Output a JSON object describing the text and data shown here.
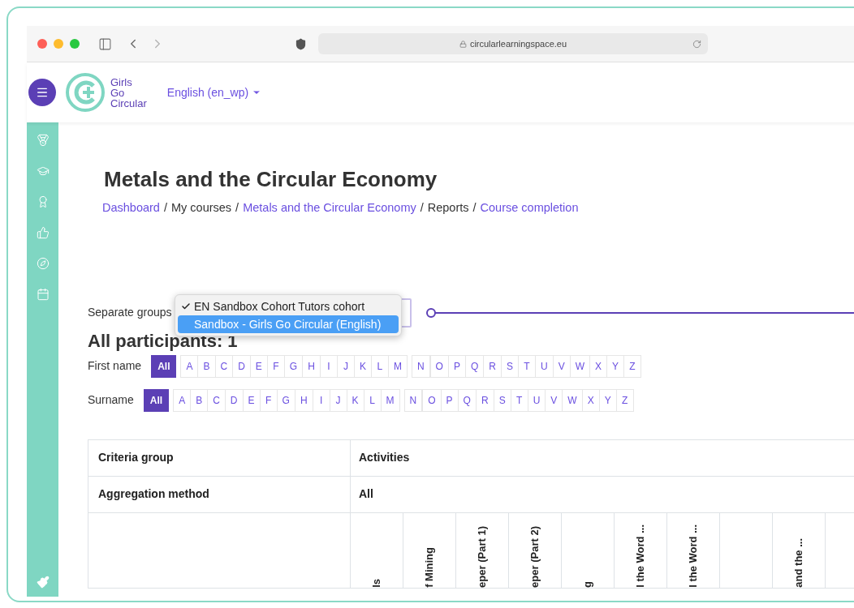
{
  "browser": {
    "url": "circularlearningspace.eu"
  },
  "header": {
    "logo_lines": [
      "Girls",
      "Go",
      "Circular"
    ],
    "language": "English (en_wp)"
  },
  "page": {
    "title": "Metals and the Circular Economy",
    "breadcrumb": [
      {
        "label": "Dashboard",
        "kind": "link"
      },
      {
        "label": "/",
        "kind": "separator"
      },
      {
        "label": "My courses",
        "kind": "text"
      },
      {
        "label": "/",
        "kind": "separator"
      },
      {
        "label": "Metals and the Circular Economy",
        "kind": "link"
      },
      {
        "label": "/",
        "kind": "separator"
      },
      {
        "label": "Reports",
        "kind": "text"
      },
      {
        "label": "/",
        "kind": "separator"
      },
      {
        "label": "Course completion",
        "kind": "link"
      }
    ]
  },
  "groups": {
    "label": "Separate groups",
    "options": [
      {
        "label": "EN Sandbox Cohort Tutors cohort",
        "checked": true,
        "selected": false
      },
      {
        "label": "Sandbox - Girls Go Circular (English)",
        "checked": false,
        "selected": true
      }
    ]
  },
  "participants_heading": "All participants: 1",
  "filters": [
    {
      "label": "First name",
      "groups": [
        [
          {
            "label": "All",
            "selected": true
          },
          {
            "label": "A",
            "selected": false
          },
          {
            "label": "B",
            "selected": false
          },
          {
            "label": "C",
            "selected": false
          },
          {
            "label": "D",
            "selected": false
          },
          {
            "label": "E",
            "selected": false
          },
          {
            "label": "F",
            "selected": false
          },
          {
            "label": "G",
            "selected": false
          },
          {
            "label": "H",
            "selected": false
          },
          {
            "label": "I",
            "selected": false
          },
          {
            "label": "J",
            "selected": false
          },
          {
            "label": "K",
            "selected": false
          },
          {
            "label": "L",
            "selected": false
          },
          {
            "label": "M",
            "selected": false
          }
        ],
        [
          {
            "label": "N",
            "selected": false
          },
          {
            "label": "O",
            "selected": false
          },
          {
            "label": "P",
            "selected": false
          },
          {
            "label": "Q",
            "selected": false
          },
          {
            "label": "R",
            "selected": false
          },
          {
            "label": "S",
            "selected": false
          },
          {
            "label": "T",
            "selected": false
          },
          {
            "label": "U",
            "selected": false
          },
          {
            "label": "V",
            "selected": false
          },
          {
            "label": "W",
            "selected": false
          },
          {
            "label": "X",
            "selected": false
          },
          {
            "label": "Y",
            "selected": false
          },
          {
            "label": "Z",
            "selected": false
          }
        ]
      ]
    },
    {
      "label": "Surname",
      "groups": [
        [
          {
            "label": "All",
            "selected": true
          },
          {
            "label": "A",
            "selected": false
          },
          {
            "label": "B",
            "selected": false
          },
          {
            "label": "C",
            "selected": false
          },
          {
            "label": "D",
            "selected": false
          },
          {
            "label": "E",
            "selected": false
          },
          {
            "label": "F",
            "selected": false
          },
          {
            "label": "G",
            "selected": false
          },
          {
            "label": "H",
            "selected": false
          },
          {
            "label": "I",
            "selected": false
          },
          {
            "label": "J",
            "selected": false
          },
          {
            "label": "K",
            "selected": false
          },
          {
            "label": "L",
            "selected": false
          },
          {
            "label": "M",
            "selected": false
          }
        ],
        [
          {
            "label": "N",
            "selected": false
          },
          {
            "label": "O",
            "selected": false
          },
          {
            "label": "P",
            "selected": false
          },
          {
            "label": "Q",
            "selected": false
          },
          {
            "label": "R",
            "selected": false
          },
          {
            "label": "S",
            "selected": false
          },
          {
            "label": "T",
            "selected": false
          },
          {
            "label": "U",
            "selected": false
          },
          {
            "label": "V",
            "selected": false
          },
          {
            "label": "W",
            "selected": false
          },
          {
            "label": "X",
            "selected": false
          },
          {
            "label": "Y",
            "selected": false
          },
          {
            "label": "Z",
            "selected": false
          }
        ]
      ]
    }
  ],
  "table": {
    "rows": [
      {
        "label": "Criteria group",
        "value": "Activities"
      },
      {
        "label": "Aggregation method",
        "value": "All"
      }
    ],
    "activity_headers": [
      {
        "kind": "text",
        "label": "ls"
      },
      {
        "kind": "text",
        "label": "f Mining"
      },
      {
        "kind": "text",
        "label": "eper (Part 1)"
      },
      {
        "kind": "text",
        "label": "eper (Part 2)"
      },
      {
        "kind": "text",
        "label": "g"
      },
      {
        "kind": "text",
        "label": "l the Word ..."
      },
      {
        "kind": "text",
        "label": "l the Word ..."
      },
      {
        "kind": "empty"
      },
      {
        "kind": "text",
        "label": "and the ..."
      }
    ]
  }
}
